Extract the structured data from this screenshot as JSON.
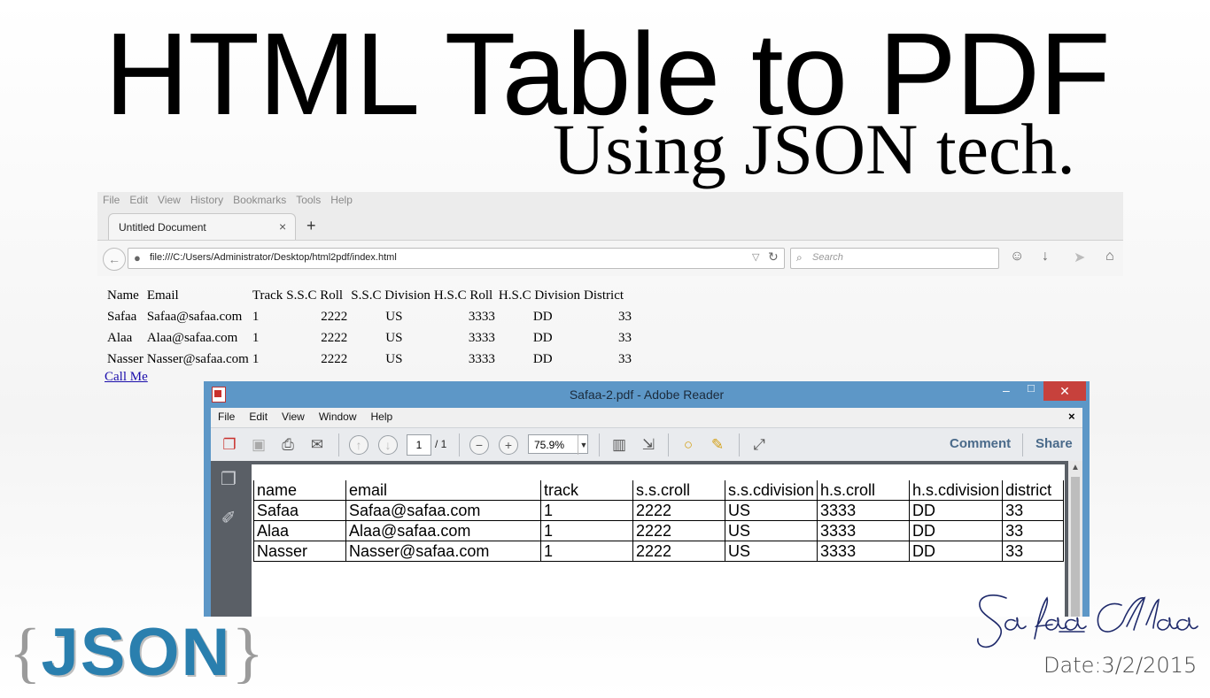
{
  "slide": {
    "title": "HTML Table to PDF",
    "subtitle": "Using JSON tech.",
    "json_logo": {
      "lbrace": "{",
      "text": "JSON",
      "rbrace": "}"
    },
    "signature": "Safaa Alaa",
    "date": "Date:3/2/2015"
  },
  "firefox": {
    "menu": [
      "File",
      "Edit",
      "View",
      "History",
      "Bookmarks",
      "Tools",
      "Help"
    ],
    "tab": {
      "label": "Untitled Document",
      "close": "×"
    },
    "new_tab": "+",
    "url": "file:///C:/Users/Administrator/Desktop/html2pdf/index.html",
    "search_placeholder": "Search",
    "icons": [
      "back-icon",
      "globe-icon",
      "reload-icon",
      "search-icon",
      "sync-icon",
      "download-icon",
      "send-icon",
      "home-icon"
    ]
  },
  "html_table": {
    "headers": [
      "Name",
      "Email",
      "Track",
      "S.S.C Roll",
      "S.S.C Division",
      "H.S.C Roll",
      "H.S.C Division",
      "District"
    ],
    "rows": [
      [
        "Safaa",
        "Safaa@safaa.com",
        "1",
        "2222",
        "US",
        "3333",
        "DD",
        "33"
      ],
      [
        "Alaa",
        "Alaa@safaa.com",
        "1",
        "2222",
        "US",
        "3333",
        "DD",
        "33"
      ],
      [
        "Nasser",
        "Nasser@safaa.com",
        "1",
        "2222",
        "US",
        "3333",
        "DD",
        "33"
      ]
    ],
    "link": "Call Me"
  },
  "reader": {
    "title": "Safaa-2.pdf - Adobe Reader",
    "window_buttons": {
      "minimize": "–",
      "maximize": "□",
      "close": "✕"
    },
    "menu": [
      "File",
      "Edit",
      "View",
      "Window",
      "Help"
    ],
    "menu_close": "×",
    "page": "1",
    "page_total": "/ 1",
    "zoom": "75.9%",
    "comment": "Comment",
    "share": "Share",
    "pdf_table": {
      "headers": [
        "name",
        "email",
        "track",
        "s.s.croll",
        "s.s.cdivision",
        "h.s.croll",
        "h.s.cdivision",
        "district"
      ],
      "rows": [
        [
          "Safaa",
          "Safaa@safaa.com",
          "1",
          "2222",
          "US",
          "3333",
          "DD",
          "33"
        ],
        [
          "Alaa",
          "Alaa@safaa.com",
          "1",
          "2222",
          "US",
          "3333",
          "DD",
          "33"
        ],
        [
          "Nasser",
          "Nasser@safaa.com",
          "1",
          "2222",
          "US",
          "3333",
          "DD",
          "33"
        ]
      ]
    }
  }
}
